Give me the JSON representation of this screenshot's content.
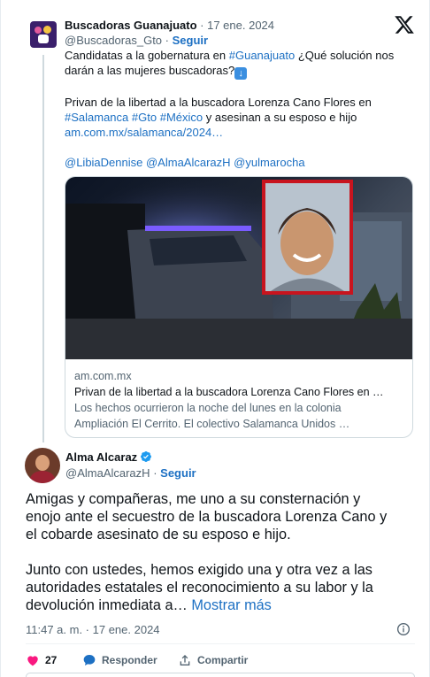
{
  "quoted": {
    "name": "Buscadoras Guanajuato",
    "date": "· 17 ene. 2024",
    "handle": "@Buscadoras_Gto",
    "separator": "·",
    "follow_label": "Seguir",
    "text_line1_pre": "Candidatas a la gobernatura en ",
    "text_line1_hashtag": "#Guanajuato",
    "text_line1_post": " ¿Qué solución nos",
    "text_line2": "darán a las mujeres buscadoras?",
    "text_para2_line1": "Privan de la libertad a la buscadora Lorenza Cano Flores en",
    "hashtag_salamanca": "#Salamanca",
    "hashtag_gto": "#Gto",
    "hashtag_mexico": "#México",
    "text_para2_line2_post": " y asesinan a su esposo e hijo",
    "link": "am.com.mx/salamanca/2024…",
    "mention1": "@LibiaDennise",
    "mention2": "@AlmaAlcarazH",
    "mention3": "@yulmarocha"
  },
  "preview": {
    "domain": "am.com.mx",
    "title": "Privan de la libertad a la buscadora Lorenza Cano Flores en …",
    "desc_line1": "Los hechos ocurrieron la noche del lunes en la colonia",
    "desc_line2": "Ampliación El Cerrito. El colectivo Salamanca Unidos …"
  },
  "main": {
    "name": "Alma Alcaraz",
    "handle": "@AlmaAlcarazH",
    "separator": "·",
    "follow_label": "Seguir",
    "para1_line1": "Amigas y compañeras, me uno a su consternación y",
    "para1_line2": "enojo ante el secuestro de la buscadora Lorenza Cano y",
    "para1_line3": "el cobarde asesinato de su esposo e hijo.",
    "para2_line1": "Junto con ustedes, hemos exigido una y otra vez a las",
    "para2_line2": "autoridades estatales el reconocimiento a su labor y la",
    "para2_line3": "devolución inmediata a…",
    "show_more": "Mostrar más",
    "timestamp": "11:47 a. m. · 17 ene. 2024"
  },
  "actions": {
    "like_count": "27",
    "reply_label": "Responder",
    "share_label": "Compartir"
  },
  "colors": {
    "link": "#1d70c3",
    "like": "#f91880",
    "muted": "#536471",
    "verified": "#1d9bf0"
  },
  "icons": [
    "x-logo-icon",
    "down-arrow-emoji-icon",
    "verified-badge-icon",
    "info-icon",
    "heart-icon",
    "reply-icon",
    "share-icon"
  ]
}
